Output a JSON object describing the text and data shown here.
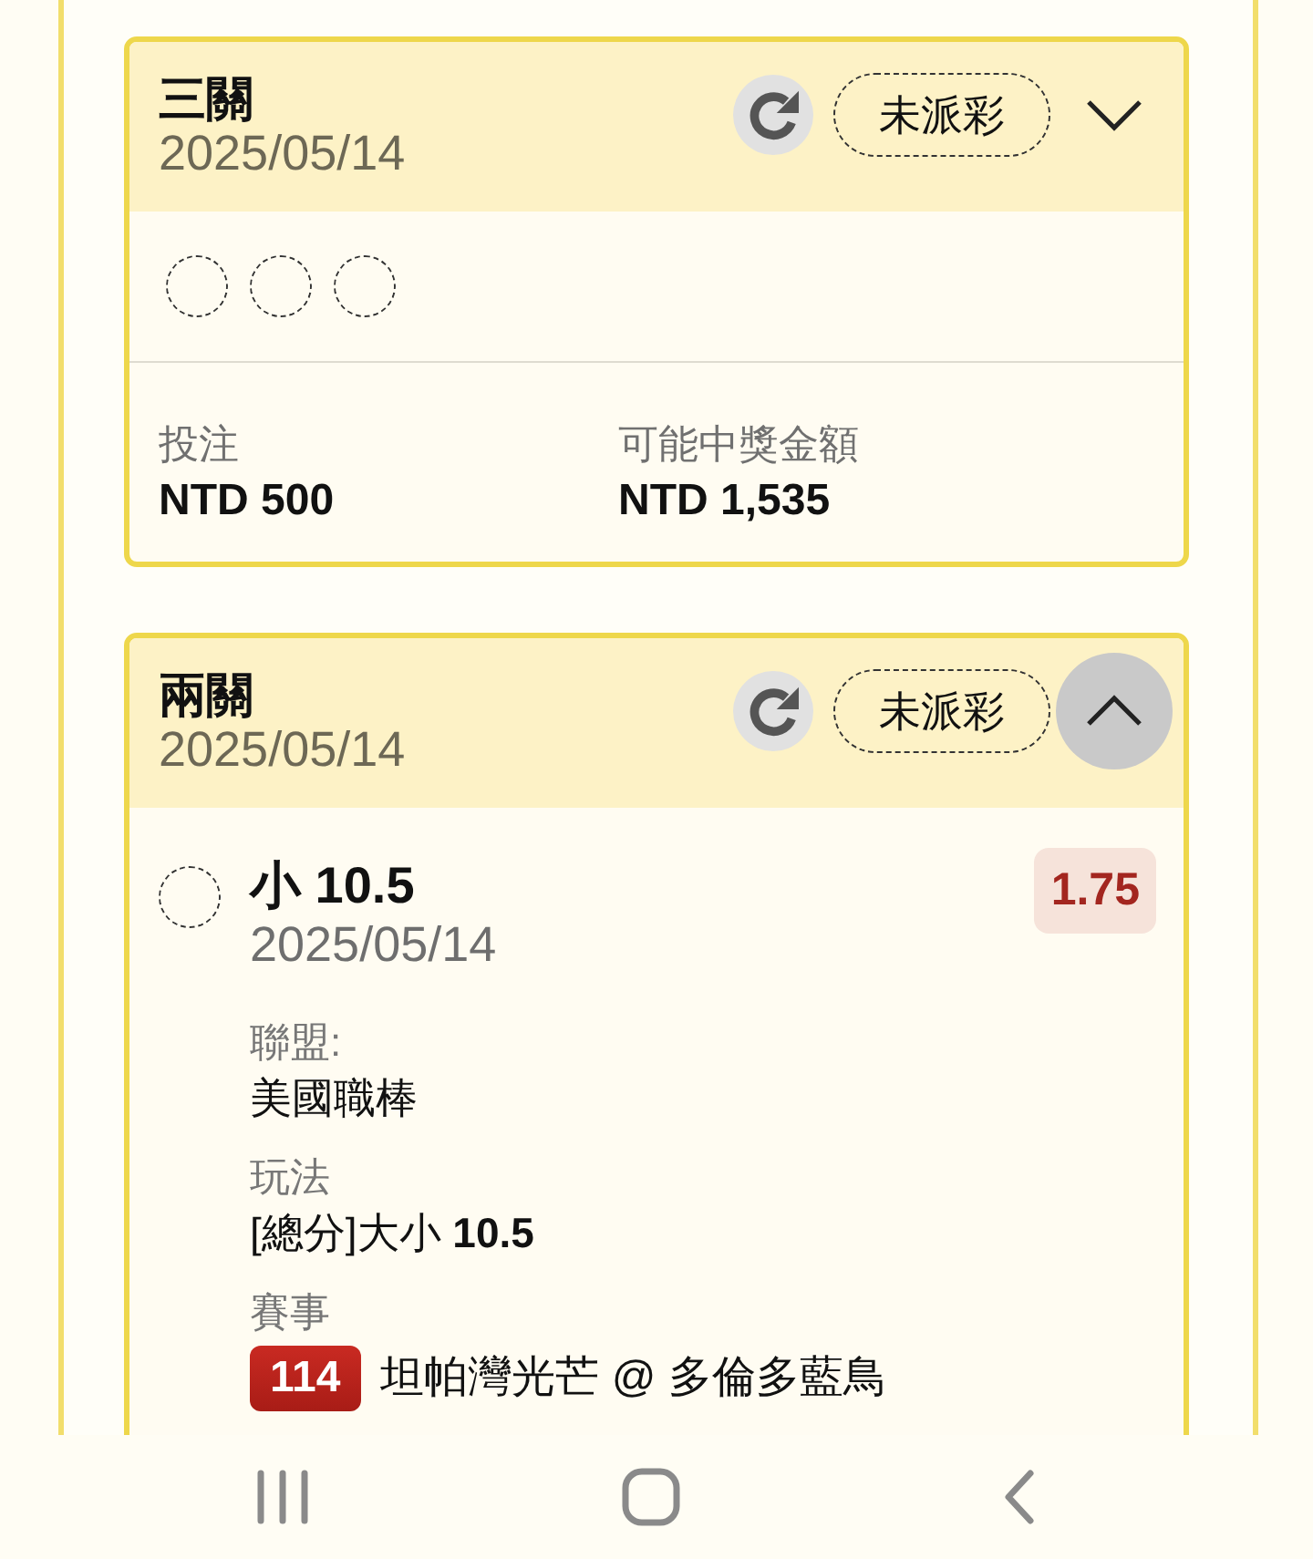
{
  "bets": [
    {
      "title": "三關",
      "date": "2025/05/14",
      "status": "未派彩",
      "expanded": false,
      "toggle_pressed": false,
      "legs": [
        {
          "settled": false
        },
        {
          "settled": false
        },
        {
          "settled": false
        }
      ],
      "stake": {
        "label": "投注",
        "value": "NTD 500"
      },
      "payout": {
        "label": "可能中獎金額",
        "value": "NTD 1,535"
      }
    },
    {
      "title": "兩關",
      "date": "2025/05/14",
      "status": "未派彩",
      "expanded": true,
      "toggle_pressed": true,
      "legs": [
        {
          "settled": false,
          "selection": "小 10.5",
          "date": "2025/05/14",
          "odds": "1.75",
          "details": [
            {
              "kind": "text",
              "label": "聯盟:",
              "value": "美國職棒"
            },
            {
              "kind": "text",
              "label": "玩法",
              "value": "[總分]大小 **10.5**"
            },
            {
              "kind": "event",
              "label": "賽事",
              "number": "114",
              "value": "坦帕灣光芒 @ 多倫多藍鳥"
            }
          ]
        }
      ]
    }
  ]
}
